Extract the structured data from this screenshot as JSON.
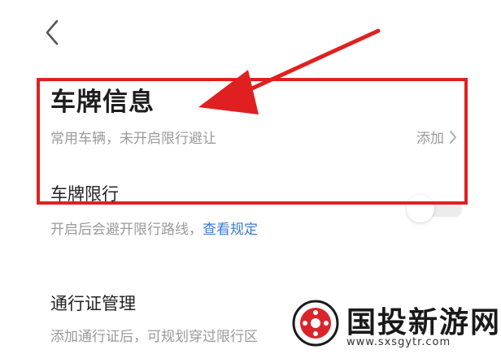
{
  "header": {
    "back_icon": "chevron-left-icon"
  },
  "plate_section": {
    "title": "车牌信息",
    "subtitle": "常用车辆，未开启限行避让",
    "action_label": "添加"
  },
  "restriction": {
    "label": "车牌限行",
    "description": "开启后会避开限行路线，",
    "link_label": "查看规定",
    "enabled": false
  },
  "permit": {
    "label": "通行证管理",
    "description": "添加通行证后，可规划穿过限行区"
  },
  "annotation": {
    "color": "#e02020"
  },
  "watermark": {
    "text": "国投新游网",
    "url": "www.sxsgytr.com"
  },
  "colors": {
    "link": "#3a7bd5",
    "secondary_text": "#9a9a9a"
  }
}
